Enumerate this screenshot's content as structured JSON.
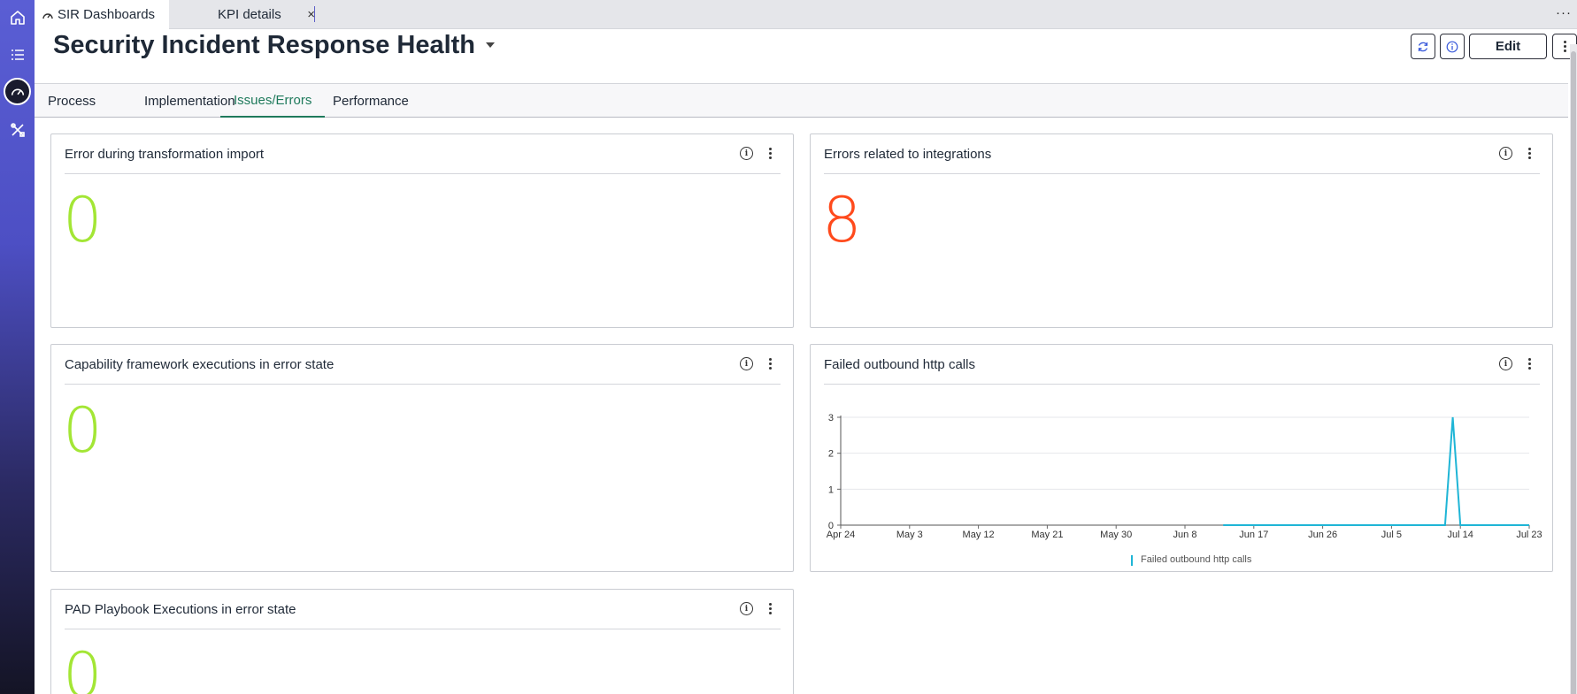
{
  "browser_tabs": [
    {
      "label": "SIR Dashboards"
    },
    {
      "label": "KPI details",
      "close": "×"
    }
  ],
  "more_menu": "···",
  "page": {
    "title": "Security Incident Response Health",
    "edit_label": "Edit"
  },
  "dashboard_tabs": [
    {
      "label": "Process"
    },
    {
      "label": "Implementation"
    },
    {
      "label": "Issues/Errors",
      "active": true
    },
    {
      "label": "Performance"
    }
  ],
  "cards": {
    "transform_errors": {
      "title": "Error during transformation import",
      "value": "0",
      "color": "#a3e635"
    },
    "integration_errors": {
      "title": "Errors related to integrations",
      "value": "8",
      "color": "#ff4a1c"
    },
    "capability_errors": {
      "title": "Capability framework executions in error state",
      "value": "0",
      "color": "#a3e635"
    },
    "http_calls": {
      "title": "Failed outbound http calls"
    },
    "pad_errors": {
      "title": "PAD Playbook Executions in error state",
      "value": "0",
      "color": "#a3e635"
    }
  },
  "chart_data": {
    "type": "line",
    "title": "Failed outbound http calls",
    "x_tick_labels": [
      "Apr 24",
      "May 3",
      "May 12",
      "May 21",
      "May 30",
      "Jun 8",
      "Jun 17",
      "Jun 26",
      "Jul 5",
      "Jul 14",
      "Jul 23"
    ],
    "xlim": [
      "Apr 24",
      "Jul 23"
    ],
    "y_ticks": [
      0,
      1,
      2,
      3
    ],
    "ylim": [
      0,
      3
    ],
    "grid": true,
    "legend_position": "bottom",
    "series": [
      {
        "name": "Failed outbound http calls",
        "color": "#1fb5d6",
        "points": [
          {
            "x": "Jun 13",
            "y": 0
          },
          {
            "x": "Jul 12",
            "y": 0
          },
          {
            "x": "Jul 13",
            "y": 3
          },
          {
            "x": "Jul 14",
            "y": 0
          },
          {
            "x": "Jul 23",
            "y": 0
          }
        ]
      }
    ]
  }
}
